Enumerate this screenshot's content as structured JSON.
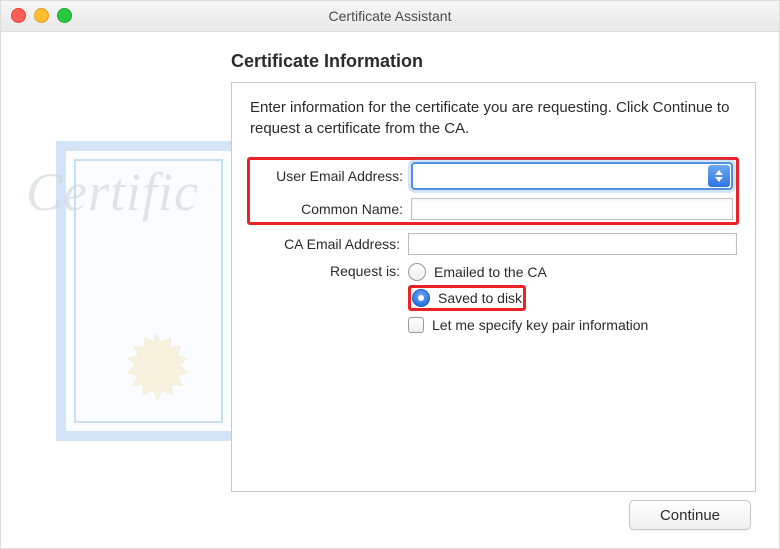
{
  "window": {
    "title": "Certificate Assistant"
  },
  "heading": "Certificate Information",
  "instructions": "Enter information for the certificate you are requesting. Click Continue to request a certificate from the CA.",
  "form": {
    "user_email": {
      "label": "User Email Address:",
      "value": ""
    },
    "common_name": {
      "label": "Common Name:",
      "value": ""
    },
    "ca_email": {
      "label": "CA Email Address:",
      "value": ""
    },
    "request_is": {
      "label": "Request is:",
      "opt_emailed": "Emailed to the CA",
      "opt_saved": "Saved to disk",
      "selected": "saved"
    },
    "specify_keypair": {
      "label": "Let me specify key pair information",
      "checked": false
    }
  },
  "buttons": {
    "continue": "Continue"
  }
}
